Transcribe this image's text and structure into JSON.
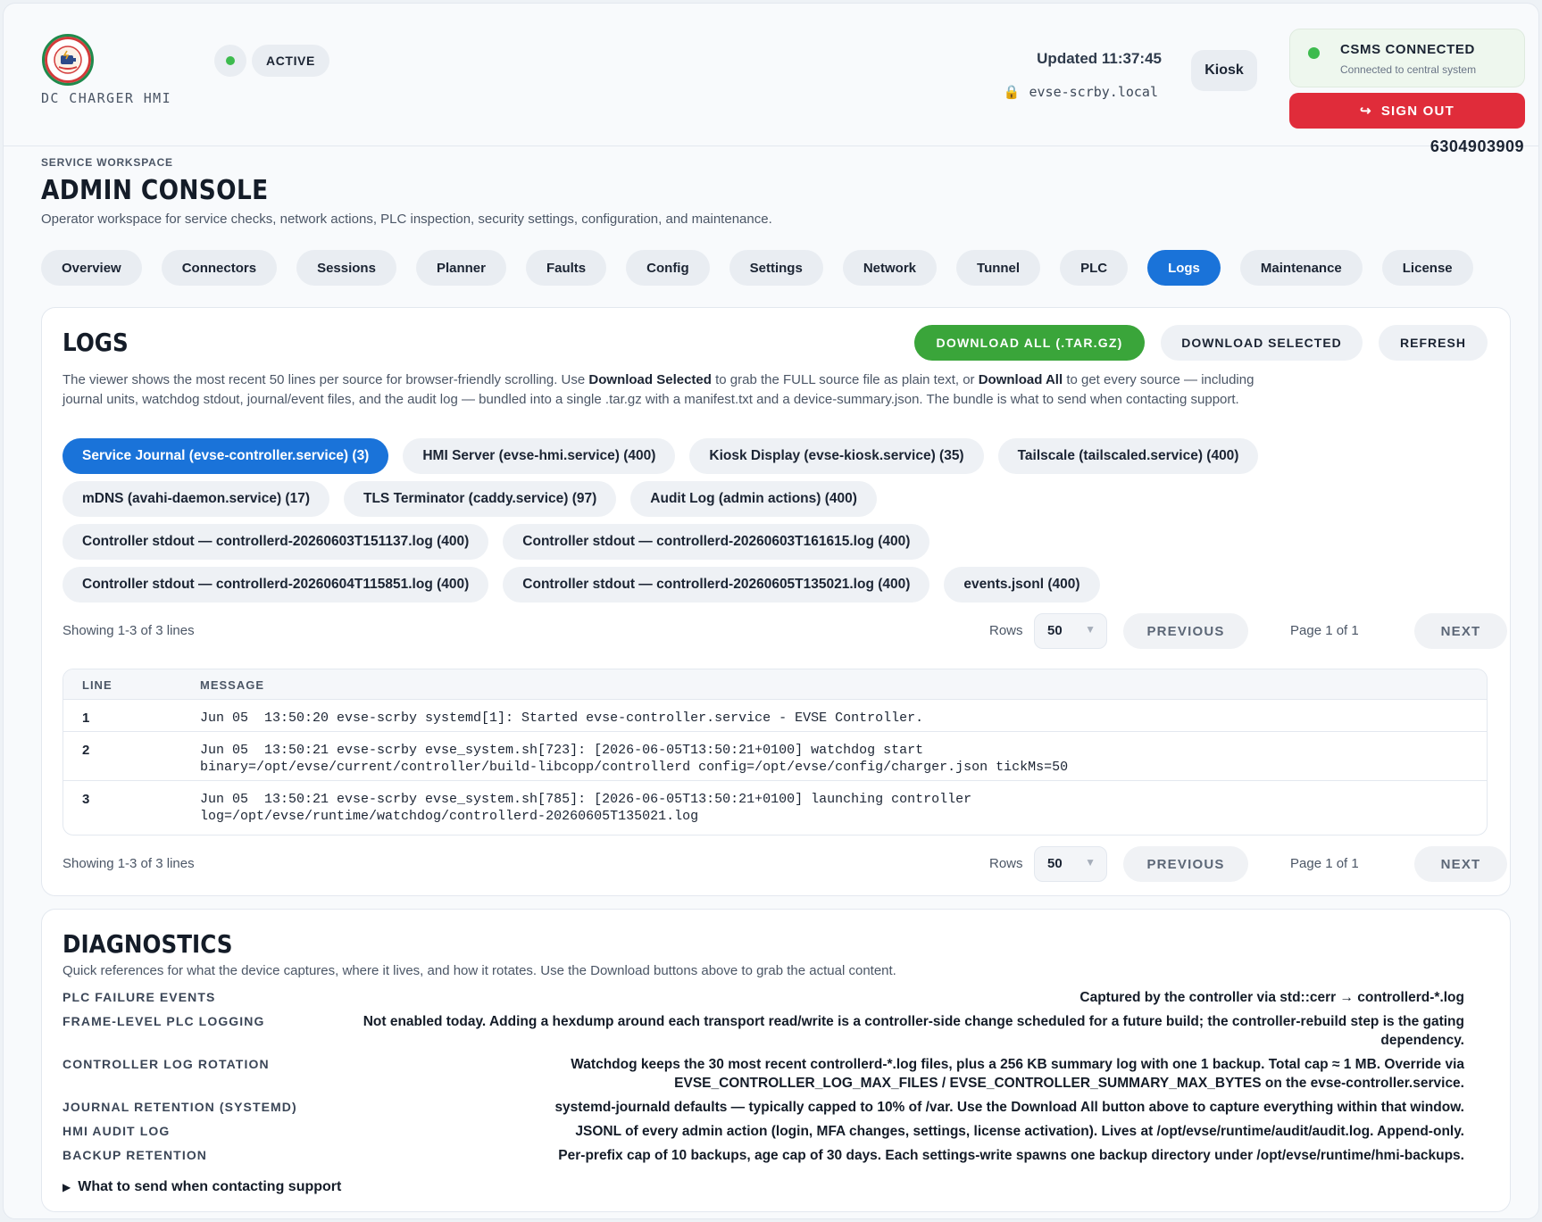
{
  "header": {
    "brand": "DC CHARGER HMI",
    "status": "ACTIVE",
    "updated": "Updated 11:37:45",
    "host": "evse-scrby.local",
    "kiosk_label": "Kiosk",
    "csms_title": "CSMS CONNECTED",
    "csms_sub": "Connected to central system",
    "signout_label": "SIGN OUT",
    "serial": "6304903909"
  },
  "page": {
    "eyebrow": "SERVICE WORKSPACE",
    "title": "ADMIN CONSOLE",
    "subtitle": "Operator workspace for service checks, network actions, PLC inspection, security settings, configuration, and maintenance."
  },
  "tabs": [
    "Overview",
    "Connectors",
    "Sessions",
    "Planner",
    "Faults",
    "Config",
    "Settings",
    "Network",
    "Tunnel",
    "PLC",
    "Logs",
    "Maintenance",
    "License"
  ],
  "active_tab": "Logs",
  "logs": {
    "title": "LOGS",
    "download_all": "DOWNLOAD ALL (.TAR.GZ)",
    "download_selected": "DOWNLOAD SELECTED",
    "refresh": "REFRESH",
    "desc_1": "The viewer shows the most recent 50 lines per source for browser-friendly scrolling. Use ",
    "desc_b1": "Download Selected",
    "desc_2": " to grab the FULL source file as plain text, or ",
    "desc_b2": "Download All",
    "desc_3": " to get every source — including journal units, watchdog stdout, journal/event files, and the audit log — bundled into a single .tar.gz with a manifest.txt and a device-summary.json. The bundle is what to send when contacting support.",
    "sources": [
      [
        "Service Journal (evse-controller.service) (3)",
        "HMI Server (evse-hmi.service) (400)",
        "Kiosk Display (evse-kiosk.service) (35)",
        "Tailscale (tailscaled.service) (400)"
      ],
      [
        "mDNS (avahi-daemon.service) (17)",
        "TLS Terminator (caddy.service) (97)",
        "Audit Log (admin actions) (400)"
      ],
      [
        "Controller stdout — controllerd-20260603T151137.log (400)",
        "Controller stdout — controllerd-20260603T161615.log (400)"
      ],
      [
        "Controller stdout — controllerd-20260604T115851.log (400)",
        "Controller stdout — controllerd-20260605T135021.log (400)",
        "events.jsonl (400)"
      ]
    ],
    "active_source": "Service Journal (evse-controller.service) (3)",
    "pager": {
      "showing": "Showing 1-3 of 3 lines",
      "rows_label": "Rows",
      "rows_value": "50",
      "previous": "PREVIOUS",
      "page_info": "Page 1 of 1",
      "next": "NEXT"
    },
    "table": {
      "col_line": "LINE",
      "col_message": "MESSAGE",
      "rows": [
        {
          "line": "1",
          "message": "Jun 05  13:50:20 evse-scrby systemd[1]: Started evse-controller.service - EVSE Controller."
        },
        {
          "line": "2",
          "message": "Jun 05  13:50:21 evse-scrby evse_system.sh[723]: [2026-06-05T13:50:21+0100] watchdog start\nbinary=/opt/evse/current/controller/build-libcopp/controllerd config=/opt/evse/config/charger.json tickMs=50"
        },
        {
          "line": "3",
          "message": "Jun 05  13:50:21 evse-scrby evse_system.sh[785]: [2026-06-05T13:50:21+0100] launching controller\nlog=/opt/evse/runtime/watchdog/controllerd-20260605T135021.log"
        }
      ]
    }
  },
  "diagnostics": {
    "title": "DIAGNOSTICS",
    "desc": "Quick references for what the device captures, where it lives, and how it rotates. Use the Download buttons above to grab the actual content.",
    "items": [
      {
        "key": "PLC FAILURE EVENTS",
        "value": "Captured by the controller via std::cerr → controllerd-*.log"
      },
      {
        "key": "FRAME-LEVEL PLC LOGGING",
        "value": "Not enabled today. Adding a hexdump around each transport read/write is a controller-side change scheduled for a future build; the controller-rebuild step is the gating dependency."
      },
      {
        "key": "CONTROLLER LOG ROTATION",
        "value": "Watchdog keeps the 30 most recent controllerd-*.log files, plus a 256 KB summary log with one 1 backup. Total cap ≈ 1 MB. Override via EVSE_CONTROLLER_LOG_MAX_FILES / EVSE_CONTROLLER_SUMMARY_MAX_BYTES on the evse-controller.service."
      },
      {
        "key": "JOURNAL RETENTION (SYSTEMD)",
        "value": "systemd-journald defaults — typically capped to 10% of /var. Use the Download All button above to capture everything within that window."
      },
      {
        "key": "HMI AUDIT LOG",
        "value": "JSONL of every admin action (login, MFA changes, settings, license activation). Lives at /opt/evse/runtime/audit/audit.log. Append-only."
      },
      {
        "key": "BACKUP RETENTION",
        "value": "Per-prefix cap of 10 backups, age cap of 30 days. Each settings-write spawns one backup directory under /opt/evse/runtime/hmi-backups."
      }
    ],
    "support": "What to send when contacting support"
  },
  "icons": {
    "lock": "lock-icon",
    "signout": "logout-icon",
    "chevron": "chevron-down-icon",
    "disclosure": "triangle-right-icon"
  },
  "colors": {
    "accent": "#1a73d9",
    "success": "#3aa53a",
    "danger": "#e02c3a",
    "status_dot": "#3dbb4e"
  }
}
